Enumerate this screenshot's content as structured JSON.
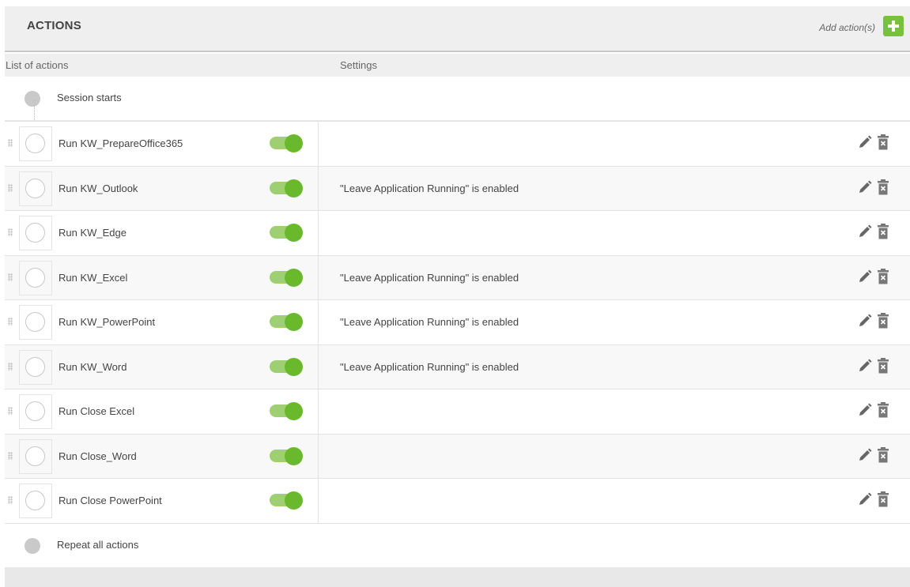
{
  "header": {
    "title": "ACTIONS",
    "add_label": "Add action(s)"
  },
  "columns": {
    "list": "List of actions",
    "settings": "Settings"
  },
  "start": {
    "label": "Session starts"
  },
  "end": {
    "label": "Repeat all actions"
  },
  "actions": [
    {
      "name": "Run KW_PrepareOffice365",
      "setting": "",
      "enabled": true
    },
    {
      "name": "Run KW_Outlook",
      "setting": "\"Leave Application Running\" is enabled",
      "enabled": true
    },
    {
      "name": "Run KW_Edge",
      "setting": "",
      "enabled": true
    },
    {
      "name": "Run KW_Excel",
      "setting": "\"Leave Application Running\" is enabled",
      "enabled": true
    },
    {
      "name": "Run KW_PowerPoint",
      "setting": "\"Leave Application Running\" is enabled",
      "enabled": true
    },
    {
      "name": "Run KW_Word",
      "setting": "\"Leave Application Running\" is enabled",
      "enabled": true
    },
    {
      "name": "Run Close Excel",
      "setting": "",
      "enabled": true
    },
    {
      "name": "Run Close_Word",
      "setting": "",
      "enabled": true
    },
    {
      "name": "Run Close PowerPoint",
      "setting": "",
      "enabled": true
    }
  ],
  "colors": {
    "accent": "#77c13b",
    "toggle_track": "#9fcf73",
    "toggle_knob": "#6ab82c",
    "header_bg": "#efefef"
  },
  "icons": {
    "add": "plus-icon",
    "drag": "drag-handle-icon",
    "edit": "pencil-icon",
    "delete": "trash-icon"
  }
}
